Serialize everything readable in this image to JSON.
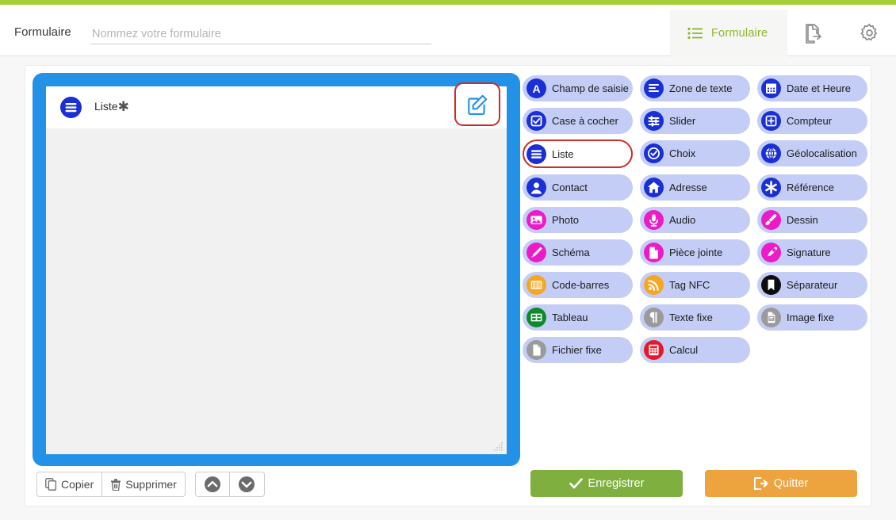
{
  "theme": {
    "accent_green": "#a5ce39",
    "tab_text_green": "#8cb62b",
    "frame_blue": "#2391e6",
    "palette_chip_bg": "#c3cdf6",
    "highlight_red": "#cf2b25",
    "save_green": "#7fb03f",
    "quit_orange": "#eda33e",
    "icon_blue": "#1a2fd6",
    "icon_magenta": "#ec1bc8",
    "icon_orange": "#f5a623",
    "icon_green": "#0d8a2a",
    "icon_grey": "#9a9a9a",
    "icon_red": "#e8182a",
    "icon_black": "#0d0d0d"
  },
  "header": {
    "title": "Formulaire",
    "name_input_value": "",
    "name_input_placeholder": "Nommez votre formulaire",
    "tab_label": "Formulaire",
    "tab_icon": "list-icon",
    "export_icon": "document-export-icon",
    "settings_icon": "gear-icon"
  },
  "form_element": {
    "label": "Liste",
    "required_marker": "✱",
    "icon": "list-lines-icon",
    "edit_icon": "pencil-square-icon",
    "resize_handle": "resize-grip-icon"
  },
  "element_toolbar": {
    "copy_label": "Copier",
    "copy_icon": "copy-icon",
    "delete_label": "Supprimer",
    "delete_icon": "trash-icon",
    "move_up_icon": "chevron-up-circle-icon",
    "move_down_icon": "chevron-down-circle-icon"
  },
  "palette": {
    "items": [
      {
        "label": "Champ de saisie",
        "icon": "letter-a-icon",
        "color": "#1a2fd6",
        "selected": false
      },
      {
        "label": "Zone de texte",
        "icon": "text-lines-icon",
        "color": "#1a2fd6",
        "selected": false
      },
      {
        "label": "Date et Heure",
        "icon": "calendar-icon",
        "color": "#1a2fd6",
        "selected": false
      },
      {
        "label": "Case à cocher",
        "icon": "checkbox-icon",
        "color": "#1a2fd6",
        "selected": false
      },
      {
        "label": "Slider",
        "icon": "sliders-icon",
        "color": "#1a2fd6",
        "selected": false
      },
      {
        "label": "Compteur",
        "icon": "plus-square-icon",
        "color": "#1a2fd6",
        "selected": false
      },
      {
        "label": "Liste",
        "icon": "list-lines-icon",
        "color": "#1a2fd6",
        "selected": true
      },
      {
        "label": "Choix",
        "icon": "check-circle-icon",
        "color": "#1a2fd6",
        "selected": false
      },
      {
        "label": "Géolocalisation",
        "icon": "globe-icon",
        "color": "#1a2fd6",
        "selected": false
      },
      {
        "label": "Contact",
        "icon": "person-icon",
        "color": "#1a2fd6",
        "selected": false
      },
      {
        "label": "Adresse",
        "icon": "home-icon",
        "color": "#1a2fd6",
        "selected": false
      },
      {
        "label": "Référence",
        "icon": "asterisk-icon",
        "color": "#1a2fd6",
        "selected": false
      },
      {
        "label": "Photo",
        "icon": "image-icon",
        "color": "#ec1bc8",
        "selected": false
      },
      {
        "label": "Audio",
        "icon": "microphone-icon",
        "color": "#ec1bc8",
        "selected": false
      },
      {
        "label": "Dessin",
        "icon": "brush-icon",
        "color": "#ec1bc8",
        "selected": false
      },
      {
        "label": "Schéma",
        "icon": "pencil-icon",
        "color": "#ec1bc8",
        "selected": false
      },
      {
        "label": "Pièce jointe",
        "icon": "file-icon",
        "color": "#ec1bc8",
        "selected": false
      },
      {
        "label": "Signature",
        "icon": "signature-pen-icon",
        "color": "#ec1bc8",
        "selected": false
      },
      {
        "label": "Code-barres",
        "icon": "barcode-icon",
        "color": "#f5a623",
        "selected": false
      },
      {
        "label": "Tag NFC",
        "icon": "rss-nfc-icon",
        "color": "#f5a623",
        "selected": false
      },
      {
        "label": "Séparateur",
        "icon": "bookmark-icon",
        "color": "#0d0d0d",
        "selected": false
      },
      {
        "label": "Tableau",
        "icon": "table-icon",
        "color": "#0d8a2a",
        "selected": false
      },
      {
        "label": "Texte fixe",
        "icon": "paragraph-icon",
        "color": "#9a9a9a",
        "selected": false
      },
      {
        "label": "Image fixe",
        "icon": "image-file-icon",
        "color": "#9a9a9a",
        "selected": false
      },
      {
        "label": "Fichier fixe",
        "icon": "file-grey-icon",
        "color": "#9a9a9a",
        "selected": false
      },
      {
        "label": "Calcul",
        "icon": "calculator-icon",
        "color": "#e8182a",
        "selected": false
      }
    ]
  },
  "footer": {
    "save_label": "Enregistrer",
    "save_icon": "check-icon",
    "quit_label": "Quitter",
    "quit_icon": "exit-icon"
  }
}
